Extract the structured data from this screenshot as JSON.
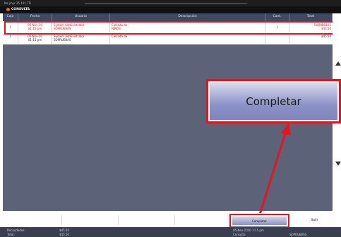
{
  "topbar": {
    "text": "No jmyr 25 101 TFl"
  },
  "window": {
    "title": "CONSULTA"
  },
  "table": {
    "headers": [
      "Caja",
      "Fecha",
      "Usuario",
      "Descripción",
      "Cant.",
      "Total"
    ],
    "rows": [
      {
        "caja": "1",
        "fecha_line1": "05-Nov-10",
        "fecha_line2": "01:15 pm",
        "usuario_line1": "System Administrator",
        "usuario_line2": "SOPRUEBAS",
        "descripcion_line1": "Calzado de",
        "descripcion_line2": "NIÑOS",
        "cantidad": "1",
        "total_line1": "FABRIBOL01",
        "total_line2": "$45.50"
      },
      {
        "caja": "1",
        "fecha_line1": "05-Nov-10",
        "fecha_line2": "01:15 pm",
        "usuario_line1": "System Administrator",
        "usuario_line2": "SOPRUEBAS",
        "descripcion_line1": "Calzado de",
        "descripcion_line2": "",
        "cantidad": "",
        "total_line1": "$45.50",
        "total_line2": ""
      }
    ]
  },
  "callout": {
    "label": "Completar"
  },
  "footer": {
    "completar_label": "Completar",
    "salir_label": "Salir"
  },
  "status": {
    "left_label": "Recaudados:",
    "left_value": "$45.50",
    "left_label2": "Total:",
    "left_value2": "$45.50",
    "datetime": "05-Nov-2010 1:15 pm",
    "right_label": "Consulta",
    "right_value": "SOPRUEBAS"
  },
  "colors": {
    "highlight": "#e5141e",
    "header_bg": "#3e4966",
    "main_bg": "#5c6277",
    "button_gradient_top": "#d9dcf0",
    "button_gradient_bottom": "#7e84bd"
  }
}
